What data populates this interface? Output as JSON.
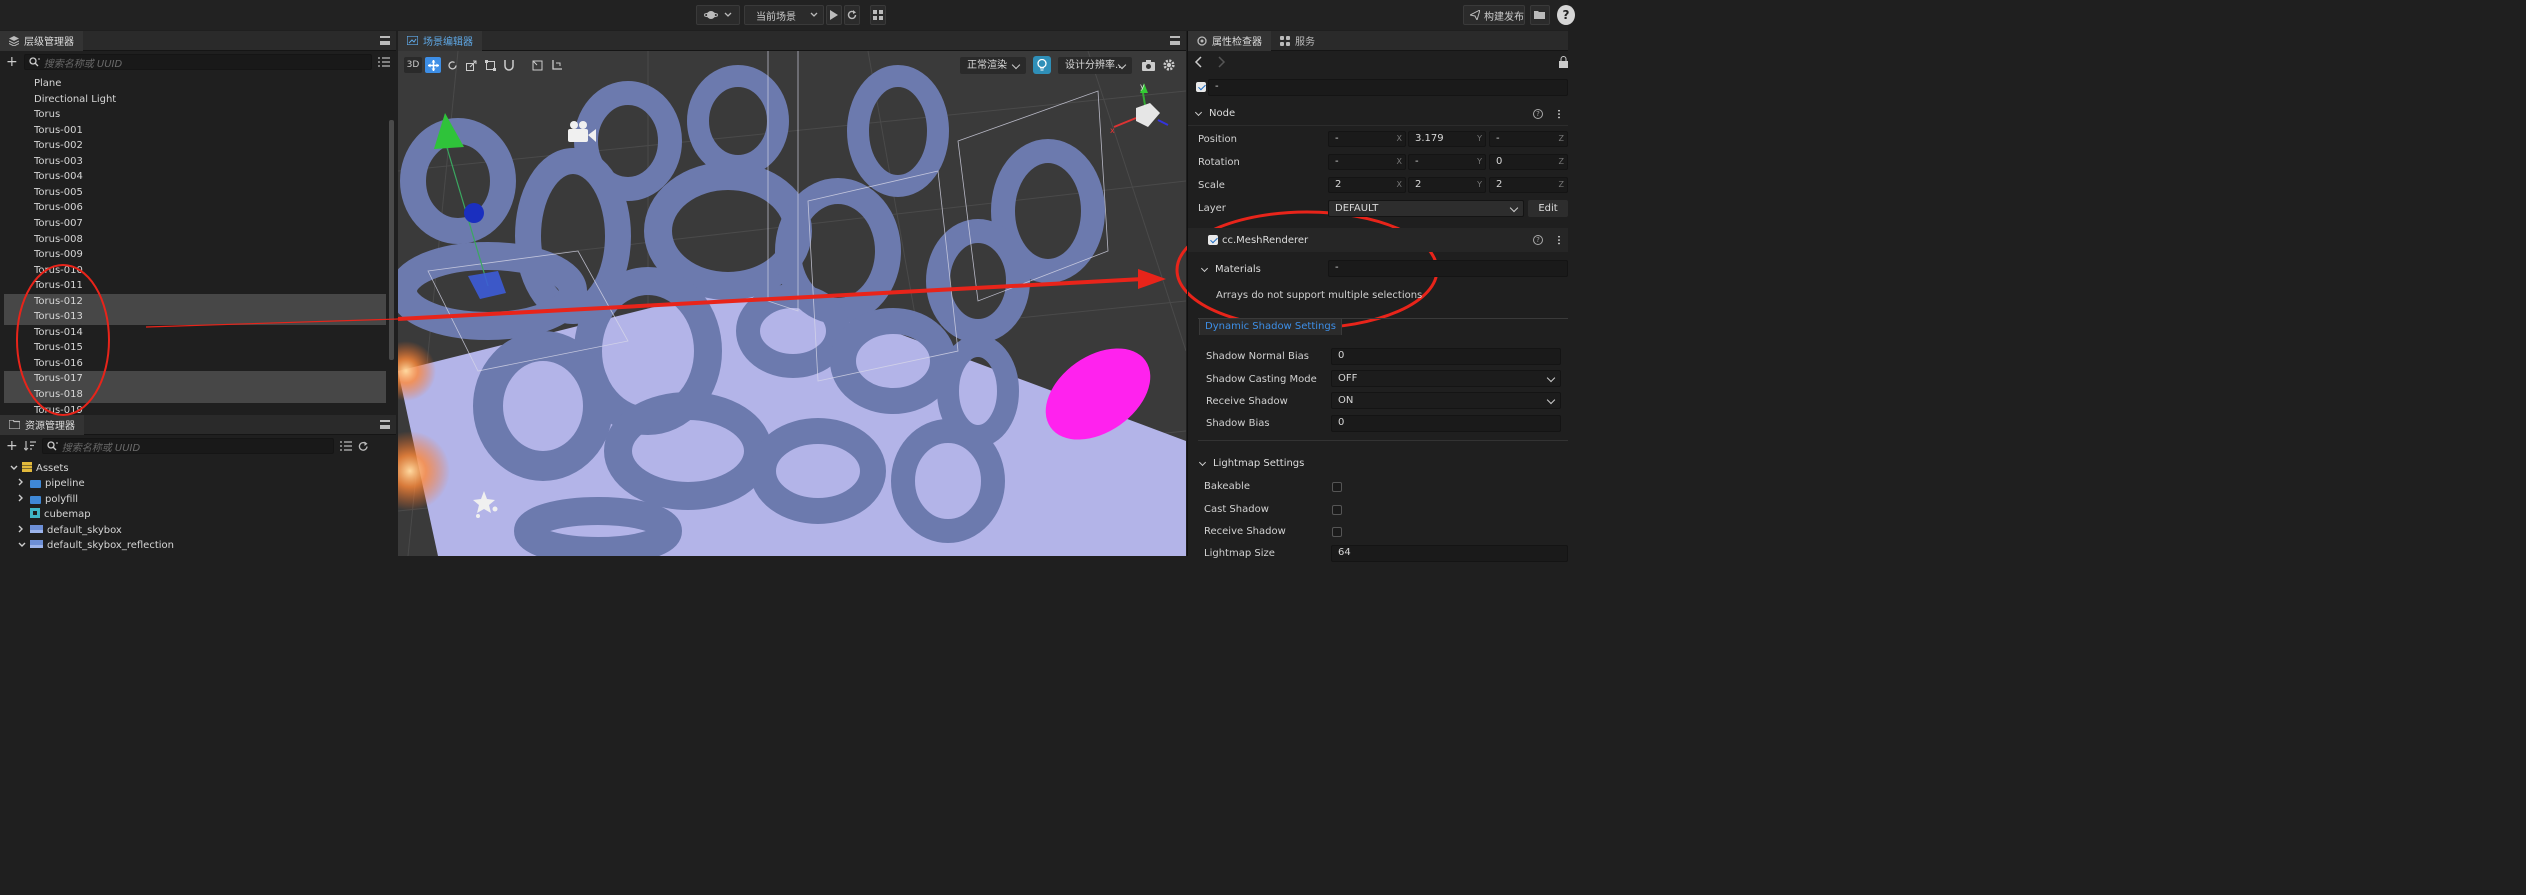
{
  "toolbar": {
    "scene_select": "当前场景",
    "build_publish": "构建发布"
  },
  "hierarchy": {
    "title": "层级管理器",
    "search_placeholder": "搜索名称或 UUID",
    "items": [
      {
        "label": "Plane",
        "selected": false
      },
      {
        "label": "Directional Light",
        "selected": false
      },
      {
        "label": "Torus",
        "selected": false
      },
      {
        "label": "Torus-001",
        "selected": false
      },
      {
        "label": "Torus-002",
        "selected": false
      },
      {
        "label": "Torus-003",
        "selected": false
      },
      {
        "label": "Torus-004",
        "selected": false
      },
      {
        "label": "Torus-005",
        "selected": false
      },
      {
        "label": "Torus-006",
        "selected": false
      },
      {
        "label": "Torus-007",
        "selected": false
      },
      {
        "label": "Torus-008",
        "selected": false
      },
      {
        "label": "Torus-009",
        "selected": false
      },
      {
        "label": "Torus-010",
        "selected": false
      },
      {
        "label": "Torus-011",
        "selected": false
      },
      {
        "label": "Torus-012",
        "selected": true
      },
      {
        "label": "Torus-013",
        "selected": true
      },
      {
        "label": "Torus-014",
        "selected": false
      },
      {
        "label": "Torus-015",
        "selected": false
      },
      {
        "label": "Torus-016",
        "selected": false
      },
      {
        "label": "Torus-017",
        "selected": true
      },
      {
        "label": "Torus-018",
        "selected": true
      },
      {
        "label": "Torus-019",
        "selected": false
      }
    ]
  },
  "assets": {
    "title": "资源管理器",
    "search_placeholder": "搜索名称或 UUID",
    "items": [
      {
        "label": "Assets",
        "kind": "db",
        "expanded": true
      },
      {
        "label": "pipeline",
        "kind": "folder",
        "expanded": false
      },
      {
        "label": "polyfill",
        "kind": "folder",
        "expanded": false
      },
      {
        "label": "cubemap",
        "kind": "cubemap",
        "expanded": false
      },
      {
        "label": "default_skybox",
        "kind": "texture",
        "expanded": false
      },
      {
        "label": "default_skybox_reflection",
        "kind": "texture",
        "expanded": true
      }
    ]
  },
  "scene": {
    "title": "场景编辑器",
    "mode_3d": "3D",
    "render_mode": "正常渲染",
    "resolution": "设计分辨率..."
  },
  "inspector": {
    "tab_inspector": "属性检查器",
    "tab_services": "服务",
    "node_name": "-",
    "node_section": "Node",
    "position": {
      "label": "Position",
      "x": "-",
      "y": "3.179",
      "z": "-"
    },
    "rotation": {
      "label": "Rotation",
      "x": "-",
      "y": "-",
      "z": "0"
    },
    "scale": {
      "label": "Scale",
      "x": "2",
      "y": "2",
      "z": "2"
    },
    "axis_x": "X",
    "axis_y": "Y",
    "axis_z": "Z",
    "layer": {
      "label": "Layer",
      "value": "DEFAULT",
      "edit": "Edit"
    },
    "component": "cc.MeshRenderer",
    "materials": {
      "label": "Materials",
      "value": "-",
      "message": "Arrays do not support multiple selections"
    },
    "dynamic_shadow": {
      "title": "Dynamic Shadow Settings",
      "normal_bias": {
        "label": "Shadow Normal Bias",
        "value": "0"
      },
      "casting_mode": {
        "label": "Shadow Casting Mode",
        "value": "OFF"
      },
      "receive": {
        "label": "Receive Shadow",
        "value": "ON"
      },
      "bias": {
        "label": "Shadow Bias",
        "value": "0"
      }
    },
    "lightmap": {
      "title": "Lightmap Settings",
      "bakeable": "Bakeable",
      "cast_shadow": "Cast Shadow",
      "receive_shadow": "Receive Shadow",
      "lightmap_size": {
        "label": "Lightmap Size",
        "value": "64"
      }
    }
  },
  "colors": {
    "accent": "#3d8ee6",
    "annotation": "#e8241a",
    "plane": "#b3b4e8",
    "torus": "#6c7aae",
    "magenta": "#ff22ee"
  }
}
